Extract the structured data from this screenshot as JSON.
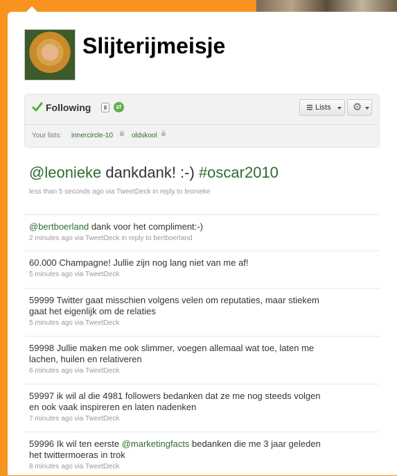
{
  "profile": {
    "screen_name": "Slijterijmeisje"
  },
  "relationship": {
    "status_label": "Following",
    "lists_button_label": "Lists",
    "your_lists_label": "Your lists:",
    "lists": [
      {
        "name": "innercircle-10",
        "private": true
      },
      {
        "name": "oldskool",
        "private": true
      }
    ]
  },
  "latest_tweet": {
    "mention": "@leonieke",
    "text": " dankdank! :-) ",
    "hashtag": "#oscar2010",
    "meta": "less than 5 seconds ago via TweetDeck in reply to leonieke"
  },
  "timeline": [
    {
      "mention": "@bertboerland",
      "text": " dank voor het compliment:-)",
      "mention_mid": "",
      "text_after": "",
      "meta": "2 minutes ago via TweetDeck in reply to bertboerland"
    },
    {
      "mention": "",
      "text": "60.000 Champagne! Jullie zijn nog lang niet van me af!",
      "mention_mid": "",
      "text_after": "",
      "meta": "5 minutes ago via TweetDeck"
    },
    {
      "mention": "",
      "text": "59999 Twitter gaat misschien volgens velen om reputaties, maar stiekem gaat het eigenlijk om de relaties",
      "mention_mid": "",
      "text_after": "",
      "meta": "5 minutes ago via TweetDeck"
    },
    {
      "mention": "",
      "text": "59998 Jullie maken me ook slimmer, voegen allemaal wat toe, laten me lachen, huilen en relativeren",
      "mention_mid": "",
      "text_after": "",
      "meta": "6 minutes ago via TweetDeck"
    },
    {
      "mention": "",
      "text": "59997 ik wil al die 4981 followers bedanken dat ze me nog steeds volgen en ook vaak inspireren en laten nadenken",
      "mention_mid": "",
      "text_after": "",
      "meta": "7 minutes ago via TweetDeck"
    },
    {
      "mention": "",
      "text": "59996 Ik wil ten eerste ",
      "mention_mid": "@marketingfacts",
      "text_after": " bedanken die me 3 jaar geleden het twittermoeras in trok",
      "meta": "8 minutes ago via TweetDeck"
    }
  ],
  "colors": {
    "page_background": "#f7931e",
    "link": "#2f6b2f",
    "check": "#4caf2e",
    "retweet": "#5db04a"
  }
}
